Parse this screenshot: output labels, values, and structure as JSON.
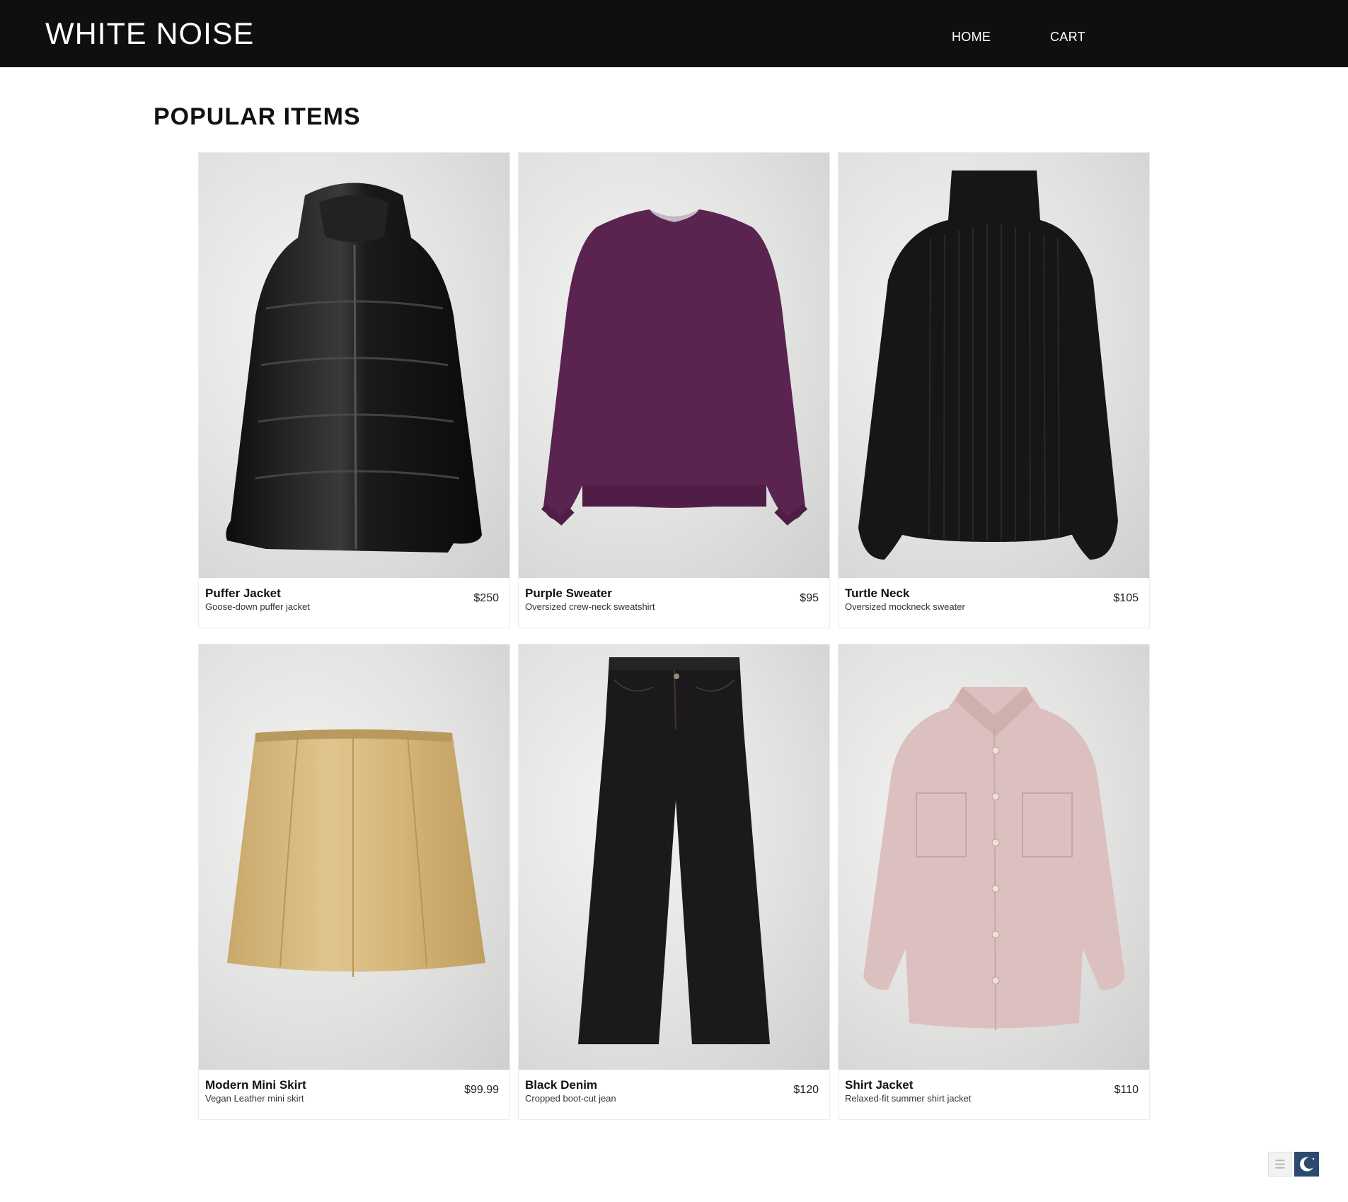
{
  "header": {
    "brand": "WHITE NOISE",
    "nav": {
      "home": "HOME",
      "cart": "CART"
    }
  },
  "section": {
    "title": "POPULAR ITEMS"
  },
  "products": [
    {
      "name": "Puffer Jacket",
      "description": "Goose-down puffer jacket",
      "price": "$250",
      "image_icon": "puffer-jacket-image",
      "color": "#151515"
    },
    {
      "name": "Purple Sweater",
      "description": "Oversized crew-neck sweatshirt",
      "price": "$95",
      "image_icon": "purple-sweater-image",
      "color": "#5b2350"
    },
    {
      "name": "Turtle Neck",
      "description": "Oversized mockneck sweater",
      "price": "$105",
      "image_icon": "turtleneck-sweater-image",
      "color": "#161616"
    },
    {
      "name": "Modern Mini Skirt",
      "description": "Vegan Leather mini skirt",
      "price": "$99.99",
      "image_icon": "leather-skirt-image",
      "color": "#d8b878"
    },
    {
      "name": "Black Denim",
      "description": "Cropped boot-cut jean",
      "price": "$120",
      "image_icon": "black-jeans-image",
      "color": "#1b191c"
    },
    {
      "name": "Shirt Jacket",
      "description": "Relaxed-fit summer shirt jacket",
      "price": "$110",
      "image_icon": "pink-shirt-jacket-image",
      "color": "#d9b9b8"
    }
  ],
  "widgets": {
    "menu_icon": "menu-icon",
    "theme_icon": "moon-icon"
  },
  "colors": {
    "header_bg": "#0f0f0f",
    "page_bg": "#ffffff",
    "theme_button": "#2c4a70"
  }
}
